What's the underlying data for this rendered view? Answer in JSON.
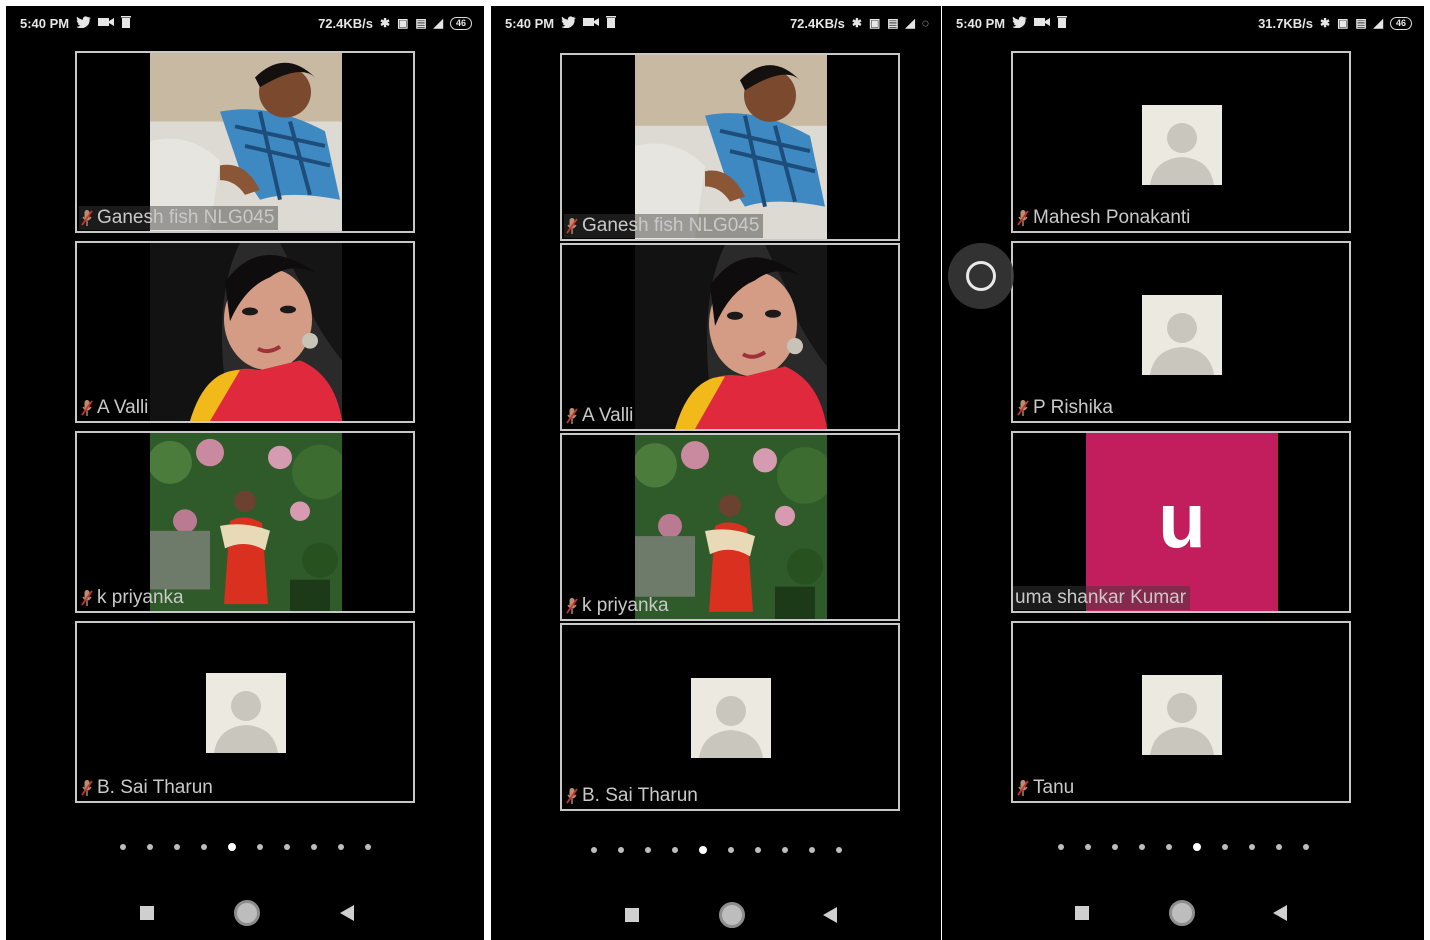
{
  "screens": [
    {
      "status": {
        "time": "5:40 PM",
        "speed": "72.4KB/s",
        "battery": "46"
      },
      "tiles": [
        {
          "name": "Ganesh fish NLG045"
        },
        {
          "name": "A Valli"
        },
        {
          "name": "k priyanka"
        },
        {
          "name": "B. Sai Tharun"
        }
      ],
      "page_dots": {
        "count": 10,
        "active_index": 4
      }
    },
    {
      "status": {
        "time": "5:40 PM",
        "speed": "72.4KB/s",
        "battery": "46"
      },
      "tiles": [
        {
          "name": "Ganesh fish NLG045"
        },
        {
          "name": "A Valli"
        },
        {
          "name": "k priyanka"
        },
        {
          "name": "B. Sai Tharun"
        }
      ],
      "page_dots": {
        "count": 10,
        "active_index": 4
      }
    },
    {
      "status": {
        "time": "5:40 PM",
        "speed": "31.7KB/s",
        "battery": "46"
      },
      "tiles": [
        {
          "name": "Mahesh Ponakanti"
        },
        {
          "name": "P Rishika"
        },
        {
          "name": "uma shankar Kumar",
          "initial": "u"
        },
        {
          "name": "Tanu"
        }
      ],
      "page_dots": {
        "count": 10,
        "active_index": 5
      }
    }
  ],
  "colors": {
    "background": "#000000",
    "tile_border": "#c8c8c8",
    "initial_avatar": "#c21d5c",
    "placeholder_avatar": "#ece9e1"
  },
  "icons": [
    "twitter-icon",
    "video-icon",
    "trash-icon",
    "mic-muted-icon",
    "square-nav-icon",
    "home-nav-icon",
    "back-nav-icon"
  ]
}
